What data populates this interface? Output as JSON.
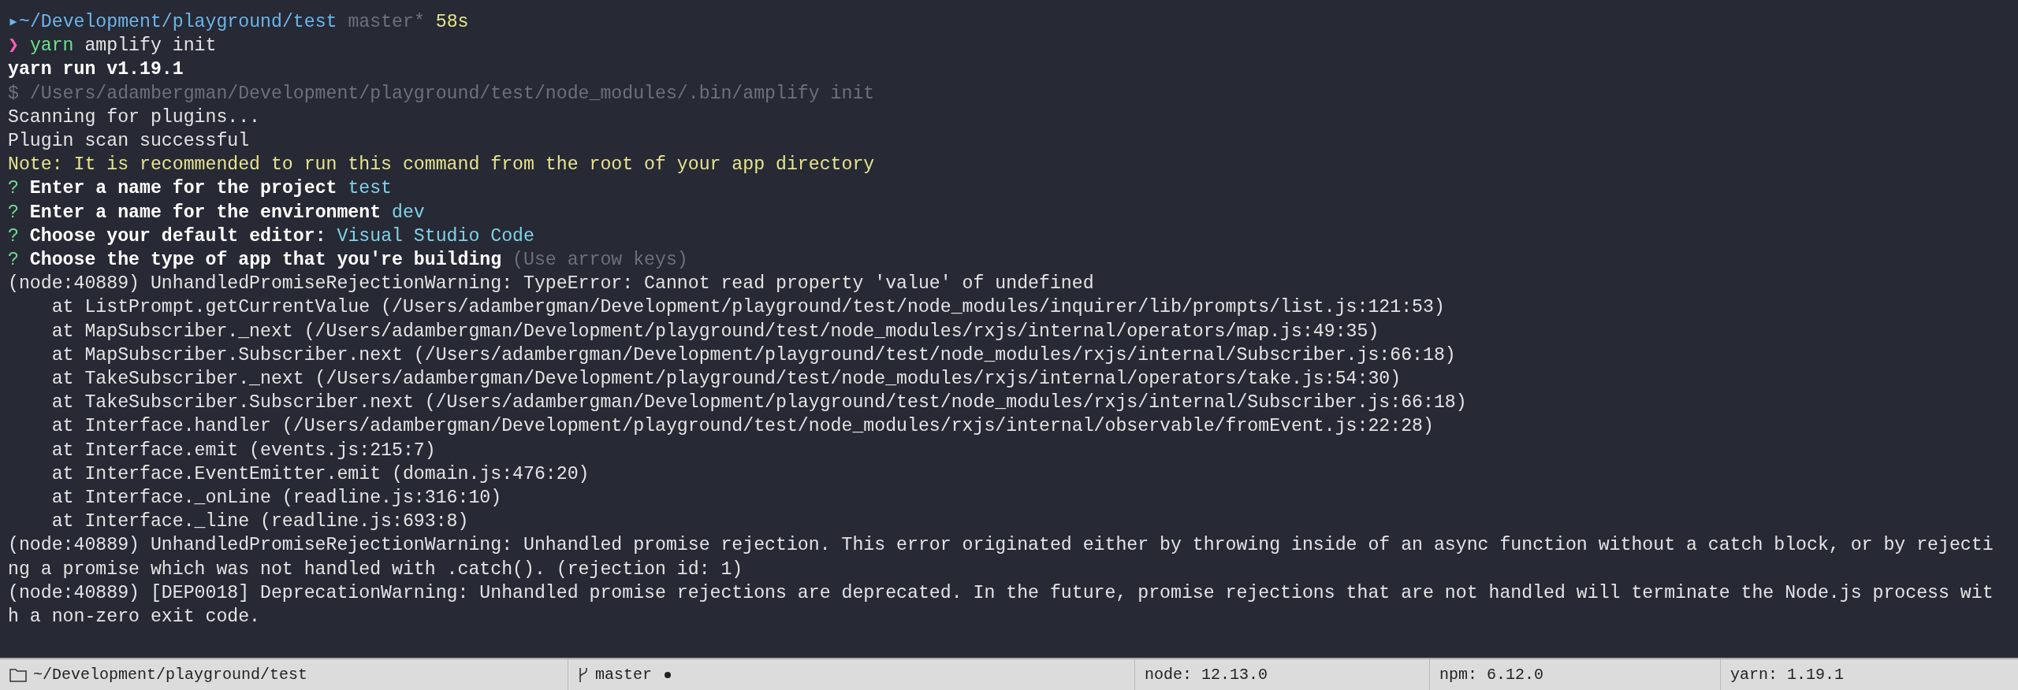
{
  "terminal": {
    "lines": [
      {
        "segments": [
          {
            "text": "▸",
            "kind": "path"
          },
          {
            "text": "~/Development/playground/test ",
            "kind": "path"
          },
          {
            "text": "master* ",
            "kind": "muted"
          },
          {
            "text": "58s",
            "kind": "yellow"
          }
        ]
      },
      {
        "segments": [
          {
            "text": "❯ ",
            "kind": "prompt"
          },
          {
            "text": "yarn ",
            "kind": "green"
          },
          {
            "text": "amplify init",
            "kind": "plain"
          }
        ]
      },
      {
        "segments": [
          {
            "text": "yarn run v1.19.1",
            "kind": "bold"
          }
        ]
      },
      {
        "segments": [
          {
            "text": "$ /Users/adambergman/Development/playground/test/node_modules/.bin/amplify init",
            "kind": "muted"
          }
        ]
      },
      {
        "segments": [
          {
            "text": "Scanning for plugins...",
            "kind": "plain"
          }
        ]
      },
      {
        "segments": [
          {
            "text": "Plugin scan successful",
            "kind": "plain"
          }
        ]
      },
      {
        "segments": [
          {
            "text": "Note: It is recommended to run this command from the root of your app directory",
            "kind": "yellow"
          }
        ]
      },
      {
        "segments": [
          {
            "text": "? ",
            "kind": "green"
          },
          {
            "text": "Enter a name for the project ",
            "kind": "bold"
          },
          {
            "text": "test",
            "kind": "cyan"
          }
        ]
      },
      {
        "segments": [
          {
            "text": "? ",
            "kind": "green"
          },
          {
            "text": "Enter a name for the environment ",
            "kind": "bold"
          },
          {
            "text": "dev",
            "kind": "cyan"
          }
        ]
      },
      {
        "segments": [
          {
            "text": "? ",
            "kind": "green"
          },
          {
            "text": "Choose your default editor: ",
            "kind": "bold"
          },
          {
            "text": "Visual Studio Code",
            "kind": "cyan"
          }
        ]
      },
      {
        "segments": [
          {
            "text": "? ",
            "kind": "green"
          },
          {
            "text": "Choose the type of app that you're building ",
            "kind": "bold"
          },
          {
            "text": "(Use arrow keys)",
            "kind": "muted"
          }
        ]
      },
      {
        "segments": [
          {
            "text": "(node:40889) UnhandledPromiseRejectionWarning: TypeError: Cannot read property 'value' of undefined",
            "kind": "plain"
          }
        ]
      },
      {
        "segments": [
          {
            "text": "    at ListPrompt.getCurrentValue (/Users/adambergman/Development/playground/test/node_modules/inquirer/lib/prompts/list.js:121:53)",
            "kind": "plain"
          }
        ]
      },
      {
        "segments": [
          {
            "text": "    at MapSubscriber._next (/Users/adambergman/Development/playground/test/node_modules/rxjs/internal/operators/map.js:49:35)",
            "kind": "plain"
          }
        ]
      },
      {
        "segments": [
          {
            "text": "    at MapSubscriber.Subscriber.next (/Users/adambergman/Development/playground/test/node_modules/rxjs/internal/Subscriber.js:66:18)",
            "kind": "plain"
          }
        ]
      },
      {
        "segments": [
          {
            "text": "    at TakeSubscriber._next (/Users/adambergman/Development/playground/test/node_modules/rxjs/internal/operators/take.js:54:30)",
            "kind": "plain"
          }
        ]
      },
      {
        "segments": [
          {
            "text": "    at TakeSubscriber.Subscriber.next (/Users/adambergman/Development/playground/test/node_modules/rxjs/internal/Subscriber.js:66:18)",
            "kind": "plain"
          }
        ]
      },
      {
        "segments": [
          {
            "text": "    at Interface.handler (/Users/adambergman/Development/playground/test/node_modules/rxjs/internal/observable/fromEvent.js:22:28)",
            "kind": "plain"
          }
        ]
      },
      {
        "segments": [
          {
            "text": "    at Interface.emit (events.js:215:7)",
            "kind": "plain"
          }
        ]
      },
      {
        "segments": [
          {
            "text": "    at Interface.EventEmitter.emit (domain.js:476:20)",
            "kind": "plain"
          }
        ]
      },
      {
        "segments": [
          {
            "text": "    at Interface._onLine (readline.js:316:10)",
            "kind": "plain"
          }
        ]
      },
      {
        "segments": [
          {
            "text": "    at Interface._line (readline.js:693:8)",
            "kind": "plain"
          }
        ]
      },
      {
        "segments": [
          {
            "text": "(node:40889) UnhandledPromiseRejectionWarning: Unhandled promise rejection. This error originated either by throwing inside of an async function without a catch block, or by rejecti",
            "kind": "plain"
          }
        ]
      },
      {
        "segments": [
          {
            "text": "ng a promise which was not handled with .catch(). (rejection id: 1)",
            "kind": "plain"
          }
        ]
      },
      {
        "segments": [
          {
            "text": "(node:40889) [DEP0018] DeprecationWarning: Unhandled promise rejections are deprecated. In the future, promise rejections that are not handled will terminate the Node.js process wit",
            "kind": "plain"
          }
        ]
      },
      {
        "segments": [
          {
            "text": "h a non-zero exit code.",
            "kind": "plain"
          }
        ]
      }
    ]
  },
  "status_bar": {
    "items": [
      {
        "kind": "folder",
        "text": "~/Development/playground/test"
      },
      {
        "kind": "branch",
        "text": "master",
        "dirty": true
      },
      {
        "kind": "plain",
        "text": "node: 12.13.0"
      },
      {
        "kind": "plain",
        "text": "npm: 6.12.0"
      },
      {
        "kind": "plain",
        "text": "yarn: 1.19.1"
      }
    ]
  }
}
